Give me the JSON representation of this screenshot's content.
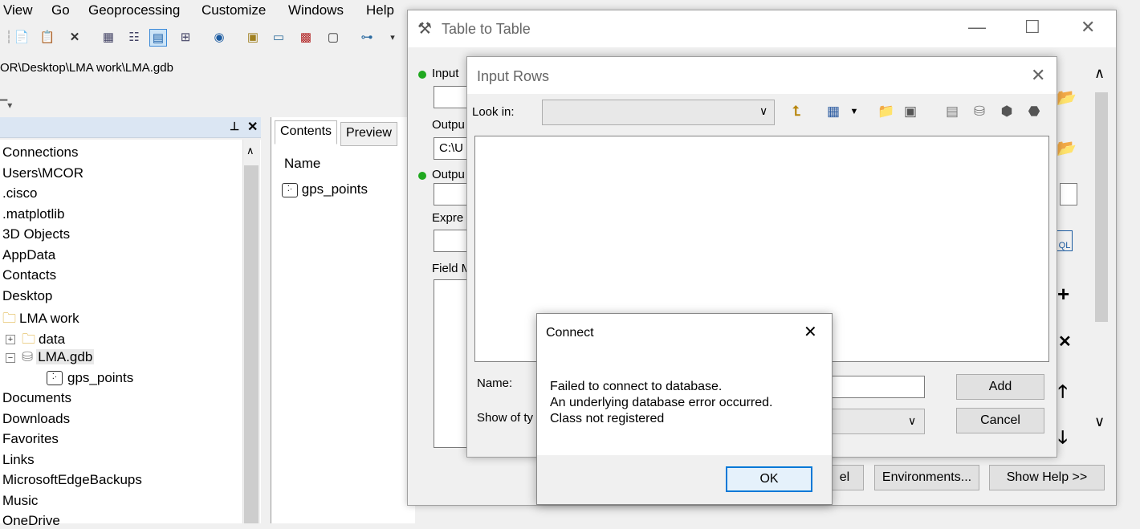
{
  "menubar": {
    "items": [
      "View",
      "Go",
      "Geoprocessing",
      "Customize",
      "Windows",
      "Help"
    ]
  },
  "path": "OR\\Desktop\\LMA work\\LMA.gdb",
  "catalog": {
    "pin_icon": "pin-icon",
    "close_glyph": "✕",
    "items": [
      {
        "label": "Connections",
        "indent": 0,
        "icon": ""
      },
      {
        "label": "Users\\MCOR",
        "indent": 0,
        "icon": ""
      },
      {
        "label": ".cisco",
        "indent": 0,
        "icon": ""
      },
      {
        "label": ".matplotlib",
        "indent": 0,
        "icon": ""
      },
      {
        "label": "3D Objects",
        "indent": 0,
        "icon": ""
      },
      {
        "label": "AppData",
        "indent": 0,
        "icon": ""
      },
      {
        "label": "Contacts",
        "indent": 0,
        "icon": ""
      },
      {
        "label": "Desktop",
        "indent": 0,
        "icon": ""
      },
      {
        "label": "LMA work",
        "indent": 1,
        "icon": "folder"
      },
      {
        "label": "data",
        "indent": 2,
        "icon": "folder",
        "expander": "+"
      },
      {
        "label": "LMA.gdb",
        "indent": 2,
        "icon": "database",
        "expander": "−"
      },
      {
        "label": "gps_points",
        "indent": 3,
        "icon": "point-feature"
      },
      {
        "label": "Documents",
        "indent": 0,
        "icon": ""
      },
      {
        "label": "Downloads",
        "indent": 0,
        "icon": ""
      },
      {
        "label": "Favorites",
        "indent": 0,
        "icon": ""
      },
      {
        "label": "Links",
        "indent": 0,
        "icon": ""
      },
      {
        "label": "MicrosoftEdgeBackups",
        "indent": 0,
        "icon": ""
      },
      {
        "label": "Music",
        "indent": 0,
        "icon": ""
      },
      {
        "label": "OneDrive",
        "indent": 0,
        "icon": ""
      }
    ]
  },
  "contents": {
    "tabs": [
      "Contents",
      "Preview"
    ],
    "column": "Name",
    "items": [
      "gps_points"
    ]
  },
  "t2t": {
    "title": "Table to Table",
    "labels": {
      "input": "Input",
      "output_loc": "Outpu",
      "output_name": "Outpu",
      "expression": "Expre",
      "field_map": "Field M"
    },
    "output_loc_value": "C:\\U",
    "buttons": {
      "cancel": "el",
      "environments": "Environments...",
      "show_help": "Show Help >>"
    }
  },
  "input_rows": {
    "title": "Input Rows",
    "look_in_label": "Look in:",
    "name_label": "Name:",
    "show_type_label": "Show of ty",
    "add_label": "Add",
    "cancel_label": "Cancel"
  },
  "connect": {
    "title": "Connect",
    "lines": [
      "Failed to connect to database.",
      "An underlying database error occurred.",
      "Class not registered"
    ],
    "ok_label": "OK"
  }
}
